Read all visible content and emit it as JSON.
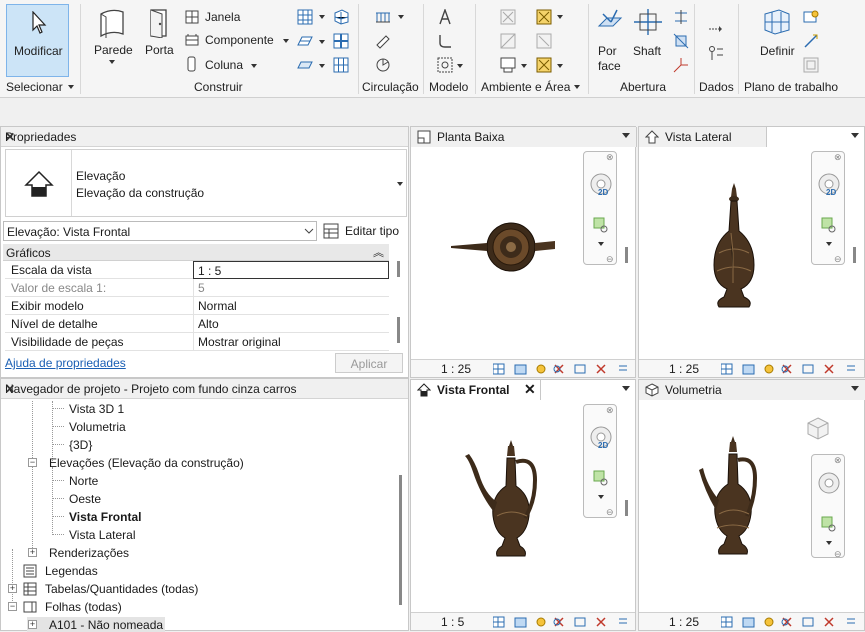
{
  "ribbon": {
    "modify_label": "Modificar",
    "wall_label": "Parede",
    "door_label": "Porta",
    "window_label": "Janela",
    "component_label": "Componente",
    "column_label": "Coluna",
    "by_face_label": "Por face",
    "shaft_label": "Shaft",
    "define_label": "Definir",
    "panels": {
      "select": "Selecionar",
      "build": "Construir",
      "circulation": "Circulação",
      "model": "Modelo",
      "room_area": "Ambiente e Área",
      "opening": "Abertura",
      "datum": "Dados",
      "work_plane": "Plano de trabalho"
    }
  },
  "properties": {
    "title": "Propriedades",
    "type_name": "Elevação",
    "type_sub": "Elevação da construção",
    "selector": "Elevação: Vista Frontal",
    "edit_type": "Editar tipo",
    "section": "Gráficos",
    "rows": [
      {
        "key": "Escala da vista",
        "value": "1 : 5"
      },
      {
        "key": "Valor de escala    1:",
        "value": "5"
      },
      {
        "key": "Exibir modelo",
        "value": "Normal"
      },
      {
        "key": "Nível de detalhe",
        "value": "Alto"
      },
      {
        "key": "Visibilidade de peças",
        "value": "Mostrar original"
      }
    ],
    "help_link": "Ajuda de propriedades",
    "apply": "Aplicar"
  },
  "browser": {
    "title": "Navegador de projeto - Projeto com fundo cinza carros",
    "items": {
      "vista3d1": "Vista 3D 1",
      "volumetria": "Volumetria",
      "v3d": "{3D}",
      "elevacoes": "Elevações (Elevação da construção)",
      "norte": "Norte",
      "oeste": "Oeste",
      "frontal": "Vista Frontal",
      "lateral": "Vista Lateral",
      "renderizacoes": "Renderizações",
      "legendas": "Legendas",
      "tabelas": "Tabelas/Quantidades (todas)",
      "folhas": "Folhas (todas)",
      "a101": "A101 - Não nomeada"
    }
  },
  "views": {
    "plan": {
      "title": "Planta Baixa",
      "scale": "1 : 25"
    },
    "side": {
      "title": "Vista Lateral",
      "scale": "1 : 25"
    },
    "front": {
      "title": "Vista Frontal",
      "scale": "1 : 5"
    },
    "volume": {
      "title": "Volumetria",
      "scale": "1 : 25"
    },
    "nav_2d": "2D"
  }
}
